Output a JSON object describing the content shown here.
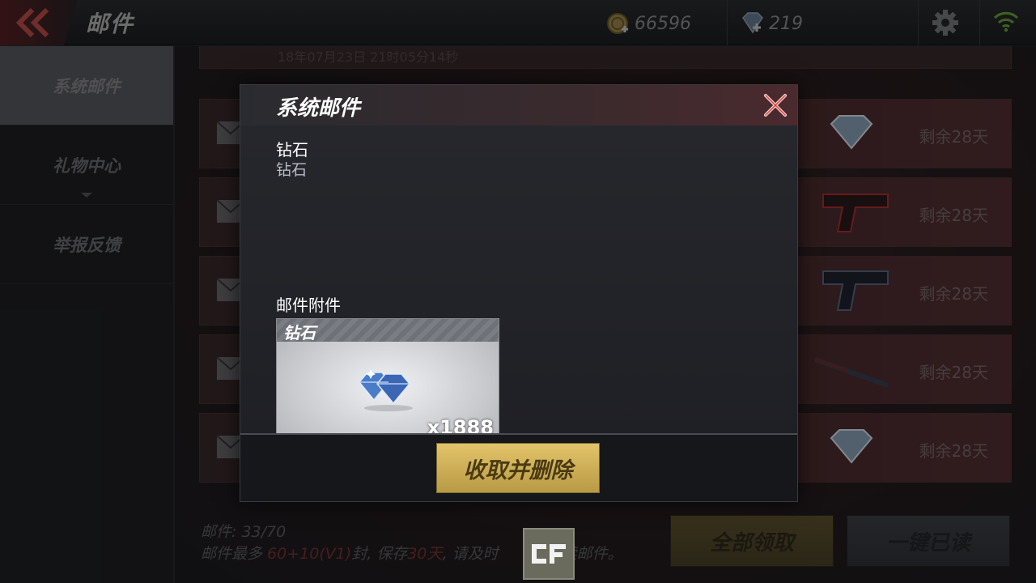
{
  "header": {
    "title": "邮件",
    "gold": "66596",
    "diamonds": "219"
  },
  "sidebar": {
    "items": [
      {
        "label": "系统邮件",
        "active": true
      },
      {
        "label": "礼物中心",
        "active": false
      },
      {
        "label": "举报反馈",
        "active": false
      }
    ]
  },
  "mail_list": {
    "top_partial_text": "18年07月23日 21时05分14秒",
    "rows": [
      {
        "remaining": "剩余28天",
        "thumb": "diamond-icon"
      },
      {
        "remaining": "剩余28天",
        "thumb": "pistol-red-icon"
      },
      {
        "remaining": "剩余28天",
        "thumb": "pistol-blue-icon"
      },
      {
        "remaining": "剩余28天",
        "thumb": "sword-icon"
      },
      {
        "remaining": "剩余28天",
        "thumb": "diamond-icon"
      }
    ]
  },
  "footer": {
    "count_label": "邮件:",
    "count_value": "33/70",
    "limit_prefix": "邮件最多 ",
    "limit_value": "60+10(V1)",
    "limit_mid": "封, 保存",
    "keep_days": "30天",
    "limit_suffix": ", 请及时",
    "limit_tail": "读邮件。",
    "claim_all": "全部领取",
    "read_all": "一键已读"
  },
  "modal": {
    "title": "系统邮件",
    "item_name": "钻石",
    "item_desc": "钻石",
    "attachment_label": "邮件附件",
    "attachment": {
      "name": "钻石",
      "quantity": "x1888",
      "icon": "diamond-icon"
    },
    "claim_button": "收取并删除"
  },
  "colors": {
    "accent_gold": "#e2c46a",
    "close_red": "#e0403a"
  }
}
